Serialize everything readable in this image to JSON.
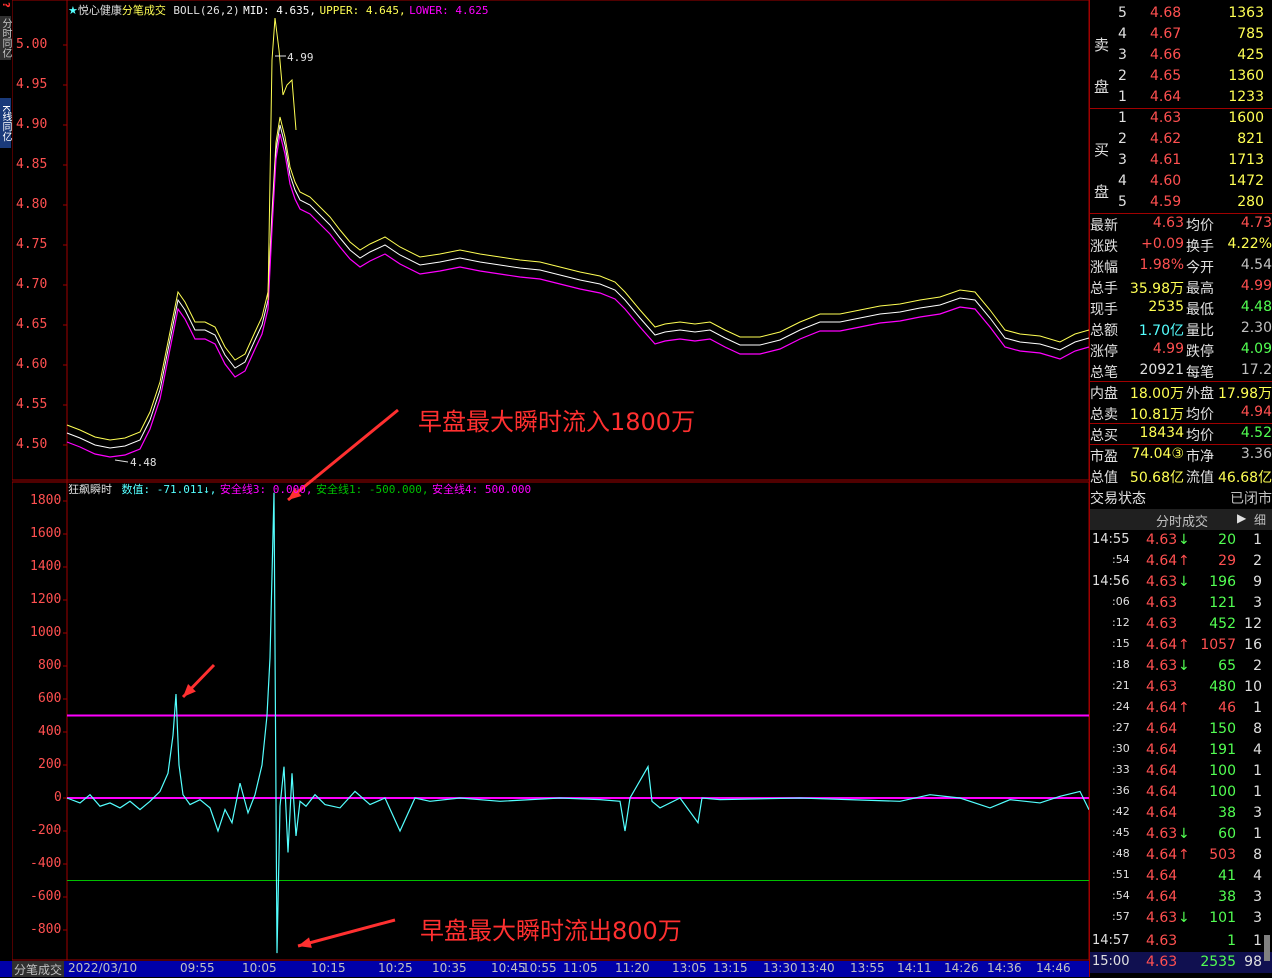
{
  "header": {
    "stock_name": "悦心健康",
    "mode": "分笔成交",
    "indicator": "BOLL(26,2)",
    "mid": "MID: 4.635,",
    "upper": "UPPER: 4.645,",
    "lower": "LOWER: 4.625"
  },
  "left_tabs": [
    "分时同亿",
    "K线同亿"
  ],
  "indicator_header": {
    "name": "狂飙瞬时",
    "value": "数值: -71.011↓,",
    "line3": "安全线3: 0.000,",
    "line1": "安全线1: -500.000,",
    "line4": "安全线4: 500.000"
  },
  "price_axis": [
    "5.00",
    "4.95",
    "4.90",
    "4.85",
    "4.80",
    "4.75",
    "4.70",
    "4.65",
    "4.60",
    "4.55",
    "4.50"
  ],
  "flow_axis": [
    "1800",
    "1600",
    "1400",
    "1200",
    "1000",
    "800",
    "600",
    "400",
    "200",
    "0",
    "-200",
    "-400",
    "-600",
    "-800"
  ],
  "price_markers": {
    "high": "4.99",
    "low": "4.48"
  },
  "annotations": {
    "inflow": "早盘最大瞬时流入1800万",
    "outflow": "早盘最大瞬时流出800万"
  },
  "time_axis": [
    "2022/03/10",
    "09:55",
    "10:05",
    "10:15",
    "10:25",
    "10:35",
    "10:45",
    "10:55",
    "11:05",
    "11:20",
    "13:05",
    "13:15",
    "13:30",
    "13:40",
    "13:55",
    "14:11",
    "14:26",
    "14:36",
    "14:46"
  ],
  "bottom_tab": "分笔成交",
  "order_book": {
    "sell_label": [
      "卖",
      "盘"
    ],
    "buy_label": [
      "买",
      "盘"
    ],
    "sells": [
      {
        "level": "5",
        "price": "4.68",
        "vol": "1363"
      },
      {
        "level": "4",
        "price": "4.67",
        "vol": "785"
      },
      {
        "level": "3",
        "price": "4.66",
        "vol": "425"
      },
      {
        "level": "2",
        "price": "4.65",
        "vol": "1360"
      },
      {
        "level": "1",
        "price": "4.64",
        "vol": "1233"
      }
    ],
    "buys": [
      {
        "level": "1",
        "price": "4.63",
        "vol": "1600"
      },
      {
        "level": "2",
        "price": "4.62",
        "vol": "821"
      },
      {
        "level": "3",
        "price": "4.61",
        "vol": "1713"
      },
      {
        "level": "4",
        "price": "4.60",
        "vol": "1472"
      },
      {
        "level": "5",
        "price": "4.59",
        "vol": "280"
      }
    ]
  },
  "stats": [
    {
      "k1": "最新",
      "v1": "4.63",
      "c1": "red",
      "k2": "均价",
      "v2": "4.73",
      "c2": "red"
    },
    {
      "k1": "涨跌",
      "v1": "+0.09",
      "c1": "red",
      "k2": "换手",
      "v2": "4.22%",
      "c2": "yellow"
    },
    {
      "k1": "涨幅",
      "v1": "1.98%",
      "c1": "red",
      "k2": "今开",
      "v2": "4.54",
      "c2": "gray"
    },
    {
      "k1": "总手",
      "v1": "35.98万",
      "c1": "yellow",
      "k2": "最高",
      "v2": "4.99",
      "c2": "red"
    },
    {
      "k1": "现手",
      "v1": "2535",
      "c1": "yellow",
      "k2": "最低",
      "v2": "4.48",
      "c2": "green"
    },
    {
      "k1": "总额",
      "v1": "1.70亿",
      "c1": "cyan",
      "k2": "量比",
      "v2": "2.30",
      "c2": "gray"
    },
    {
      "k1": "涨停",
      "v1": "4.99",
      "c1": "red",
      "k2": "跌停",
      "v2": "4.09",
      "c2": "green"
    },
    {
      "k1": "总笔",
      "v1": "20921",
      "c1": "white",
      "k2": "每笔",
      "v2": "17.2",
      "c2": "gray"
    },
    {
      "k1": "内盘",
      "v1": "18.00万",
      "c1": "yellow",
      "k2": "外盘",
      "v2": "17.98万",
      "c2": "yellow"
    },
    {
      "k1": "总卖",
      "v1": "10.81万",
      "c1": "yellow",
      "k2": "均价",
      "v2": "4.94",
      "c2": "red"
    },
    {
      "k1": "总买",
      "v1": "18434",
      "c1": "yellow",
      "k2": "均价",
      "v2": "4.52",
      "c2": "green"
    },
    {
      "k1": "市盈",
      "v1": "74.04③",
      "c1": "yellow",
      "k2": "市净",
      "v2": "3.36",
      "c2": "gray"
    },
    {
      "k1": "总值",
      "v1": "50.68亿",
      "c1": "yellow",
      "k2": "流值",
      "v2": "46.68亿",
      "c2": "yellow"
    },
    {
      "k1": "交易状态",
      "v1": "",
      "c1": "gray",
      "k2": "",
      "v2": "已闭市",
      "c2": "gray"
    }
  ],
  "ticks_header": {
    "title": "分时成交",
    "detail": "细"
  },
  "ticks": [
    {
      "time": "14:55",
      "price": "4.63",
      "arrow": "down",
      "vol": "20",
      "n": "1",
      "big": true
    },
    {
      "time": ":54",
      "price": "4.64",
      "arrow": "up",
      "vol": "29",
      "n": "2",
      "big": false
    },
    {
      "time": "14:56",
      "price": "4.63",
      "arrow": "down",
      "vol": "196",
      "n": "9",
      "big": true
    },
    {
      "time": ":06",
      "price": "4.63",
      "arrow": "",
      "vol": "121",
      "n": "3",
      "big": false
    },
    {
      "time": ":12",
      "price": "4.63",
      "arrow": "",
      "vol": "452",
      "n": "12",
      "big": false
    },
    {
      "time": ":15",
      "price": "4.64",
      "arrow": "up",
      "vol": "1057",
      "n": "16",
      "big": false
    },
    {
      "time": ":18",
      "price": "4.63",
      "arrow": "down",
      "vol": "65",
      "n": "2",
      "big": false
    },
    {
      "time": ":21",
      "price": "4.63",
      "arrow": "",
      "vol": "480",
      "n": "10",
      "big": false
    },
    {
      "time": ":24",
      "price": "4.64",
      "arrow": "up",
      "vol": "46",
      "n": "1",
      "big": false
    },
    {
      "time": ":27",
      "price": "4.64",
      "arrow": "",
      "vol": "150",
      "n": "8",
      "big": false
    },
    {
      "time": ":30",
      "price": "4.64",
      "arrow": "",
      "vol": "191",
      "n": "4",
      "big": false
    },
    {
      "time": ":33",
      "price": "4.64",
      "arrow": "",
      "vol": "100",
      "n": "1",
      "big": false
    },
    {
      "time": ":36",
      "price": "4.64",
      "arrow": "",
      "vol": "100",
      "n": "1",
      "big": false
    },
    {
      "time": ":42",
      "price": "4.64",
      "arrow": "",
      "vol": "38",
      "n": "3",
      "big": false
    },
    {
      "time": ":45",
      "price": "4.63",
      "arrow": "down",
      "vol": "60",
      "n": "1",
      "big": false
    },
    {
      "time": ":48",
      "price": "4.64",
      "arrow": "up",
      "vol": "503",
      "n": "8",
      "big": false
    },
    {
      "time": ":51",
      "price": "4.64",
      "arrow": "",
      "vol": "41",
      "n": "4",
      "big": false
    },
    {
      "time": ":54",
      "price": "4.64",
      "arrow": "",
      "vol": "38",
      "n": "3",
      "big": false
    },
    {
      "time": ":57",
      "price": "4.63",
      "arrow": "down",
      "vol": "101",
      "n": "3",
      "big": false
    },
    {
      "time": "14:57",
      "price": "4.63",
      "arrow": "",
      "vol": "1",
      "n": "1",
      "big": true
    },
    {
      "time": "15:00",
      "price": "4.63",
      "arrow": "",
      "vol": "2535",
      "n": "98",
      "big": true
    }
  ],
  "colors": {
    "grid": "#a00000",
    "upper": "#ffff54",
    "mid": "#ffffff",
    "lower": "#ff00ff",
    "flow": "#54ffff",
    "line500": "#ff00ff",
    "lineNeg500": "#00c000",
    "accent_red": "#ff3030"
  }
}
